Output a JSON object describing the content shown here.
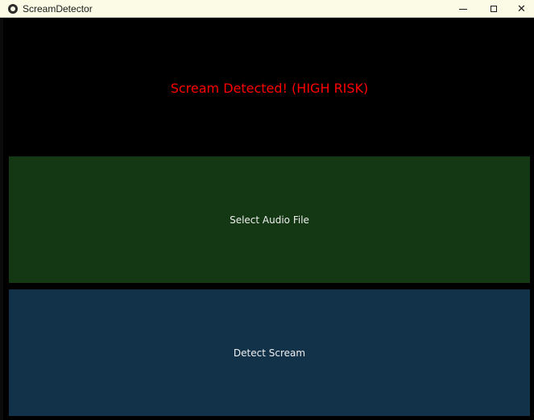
{
  "window": {
    "title": "ScreamDetector",
    "controls": {
      "minimize": "—",
      "maximize": "☐",
      "close": "✕"
    }
  },
  "status": {
    "text": "Scream Detected! (HIGH RISK)",
    "color": "#ff0000"
  },
  "buttons": {
    "select_audio": "Select Audio File",
    "detect_scream": "Detect Scream"
  },
  "colors": {
    "titlebar": "#fbfbe6",
    "background": "#000000",
    "select_button": "#143714",
    "detect_button": "#12324a"
  },
  "icons": {
    "app": "app-icon"
  }
}
